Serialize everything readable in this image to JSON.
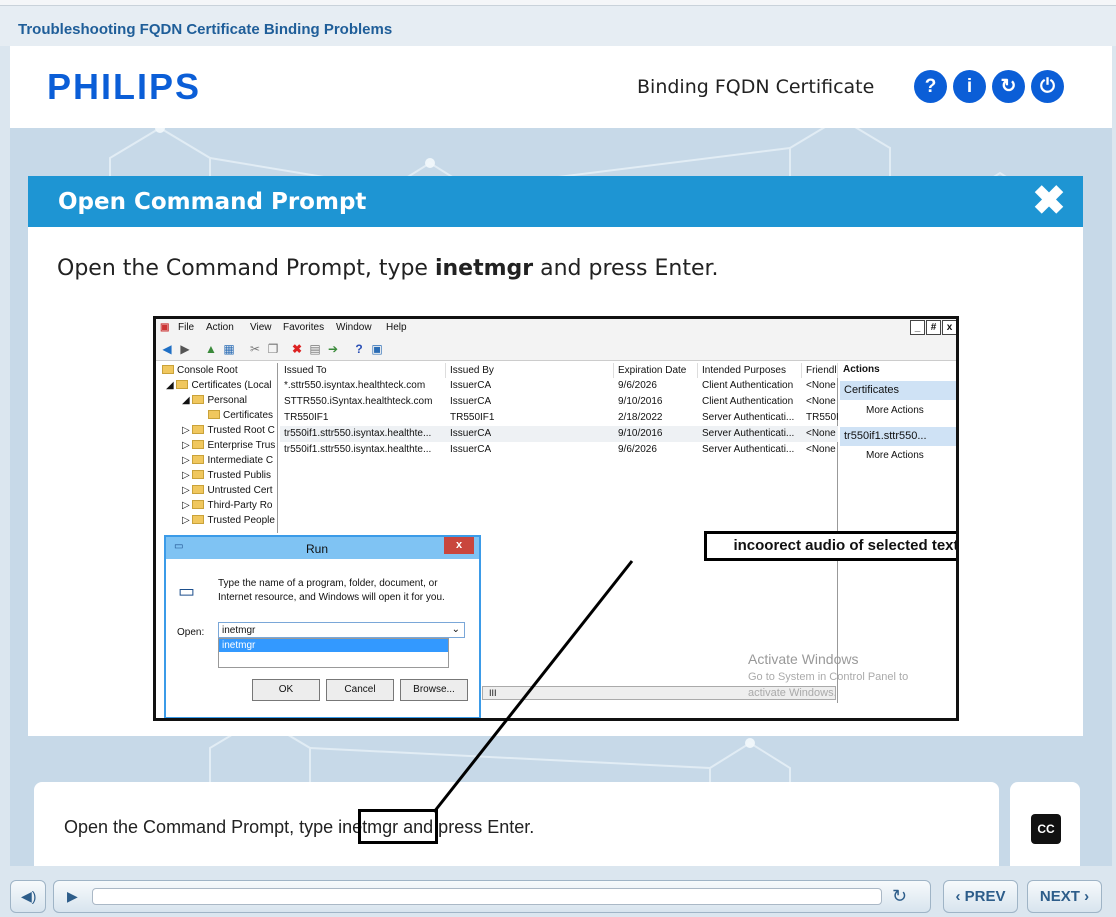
{
  "course": {
    "title": "Troubleshooting FQDN Certificate Binding Problems"
  },
  "header": {
    "logo": "PHILIPS",
    "module_title": "Binding FQDN Certificate",
    "buttons": {
      "help": "?",
      "info": "i",
      "refresh": "↻",
      "power": "⏻"
    }
  },
  "panel": {
    "title": "Open Command Prompt",
    "close": "✖",
    "instruction_prefix": "Open the Command Prompt, type ",
    "instruction_bold": "inetmgr",
    "instruction_suffix": " and press Enter."
  },
  "screenshot": {
    "menu": [
      "File",
      "Action",
      "View",
      "Favorites",
      "Window",
      "Help"
    ],
    "window_controls": [
      "_",
      "#",
      "x"
    ],
    "tree": [
      "Console Root",
      "Certificates (Local",
      "Personal",
      "Certificates",
      "Trusted Root C",
      "Enterprise Trus",
      "Intermediate C",
      "Trusted Publis",
      "Untrusted Cert",
      "Third-Party Ro",
      "Trusted People"
    ],
    "columns": [
      "Issued To",
      "Issued By",
      "Expiration Date",
      "Intended Purposes",
      "Friendl"
    ],
    "rows": [
      [
        "*.sttr550.isyntax.healthteck.com",
        "IssuerCA",
        "9/6/2026",
        "Client Authentication",
        "<None"
      ],
      [
        "STTR550.iSyntax.healthteck.com",
        "IssuerCA",
        "9/10/2016",
        "Client Authentication",
        "<None"
      ],
      [
        "TR550IF1",
        "TR550IF1",
        "2/18/2022",
        "Server Authenticati...",
        "TR550I"
      ],
      [
        "tr550if1.sttr550.isyntax.healthte...",
        "IssuerCA",
        "9/10/2016",
        "Server Authenticati...",
        "<None"
      ],
      [
        "tr550if1.sttr550.isyntax.healthte...",
        "IssuerCA",
        "9/6/2026",
        "Server Authenticati...",
        "<None"
      ]
    ],
    "actions": {
      "heading": "Actions",
      "section1": "Certificates",
      "item1": "More Actions",
      "section2": "tr550if1.sttr550...",
      "item2": "More Actions"
    },
    "watermark": {
      "line1": "Activate Windows",
      "line2": "Go to System in Control Panel to",
      "line3": "activate Windows."
    },
    "scroll_label": "III",
    "run_dialog": {
      "title": "Run",
      "close": "x",
      "description": "Type the name of a program, folder, document, or Internet resource, and Windows will open it for you.",
      "open_label": "Open:",
      "input_value": "inetmgr",
      "suggestion": "inetmgr",
      "ok": "OK",
      "cancel": "Cancel",
      "browse": "Browse..."
    }
  },
  "annotation": {
    "text": "incoorect audio of selected text"
  },
  "transcript": {
    "text": "Open the Command Prompt, type inetmgr and press Enter."
  },
  "controls": {
    "cc": "CC",
    "prev": "‹ PREV",
    "next": "NEXT ›",
    "progress": 0
  },
  "colors": {
    "brand_blue": "#0b5ed7",
    "panel_blue": "#1e95d3",
    "nav_text": "#2d5d8a"
  }
}
